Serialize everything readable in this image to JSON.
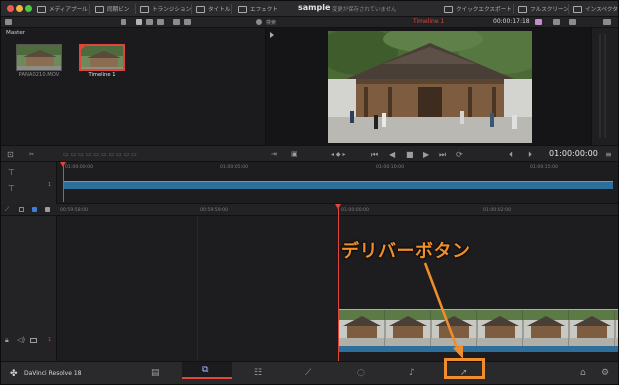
{
  "topbar": {
    "media_pool": "メディアプール",
    "clip_bin": "同期ビン",
    "transitions": "トランジション",
    "titles": "タイトル",
    "effects": "エフェクト",
    "project_title": "sample",
    "save_status": "変更が保存されていません",
    "quick_export": "クイックエクスポート",
    "fullscreen": "フルスクリーン",
    "inspector": "インスペクタ"
  },
  "subbar": {
    "search_label": "検索",
    "timeline_name": "Timeline 1",
    "timecode": "00:00:17:18"
  },
  "media_pool": {
    "folder": "Master",
    "clips": [
      {
        "label": "PANA0210.MOV"
      },
      {
        "label": "Timeline 1"
      }
    ]
  },
  "transport": {
    "timecode": "01:00:00:00"
  },
  "upper_timeline": {
    "ticks": [
      "01:00:00:00",
      "01:00:05:00",
      "01:00:10:00",
      "01:00:15:00"
    ],
    "track_number": "1"
  },
  "lower_timeline": {
    "ticks": [
      "00:59:58:00",
      "00:59:59:00",
      "01:00:00:00",
      "01:00:01:00",
      "01:00:02:00"
    ],
    "track_number": "1"
  },
  "pagebar": {
    "app_name": "DaVinci Resolve 18"
  },
  "annotation": {
    "label": "デリバーボタン",
    "color": "#f08d2c"
  },
  "colors": {
    "accent": "#e0443a",
    "clip_blue": "#2d6e9a",
    "background": "#1c1c1f"
  }
}
